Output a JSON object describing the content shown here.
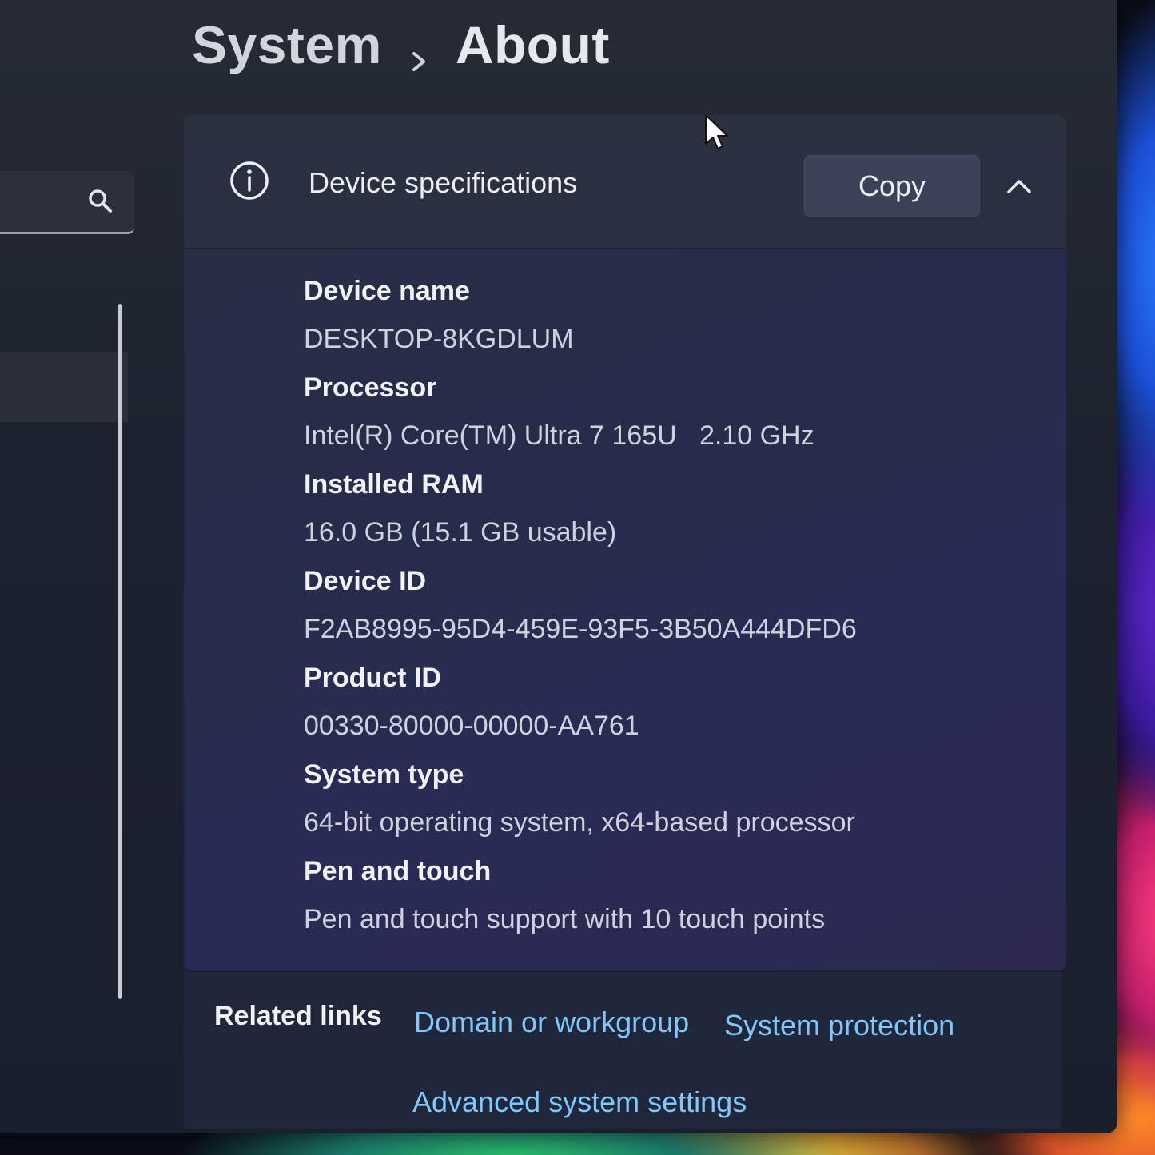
{
  "breadcrumb": {
    "parent": "System",
    "current": "About"
  },
  "search": {
    "placeholder": ""
  },
  "device_specs": {
    "title": "Device specifications",
    "copy_label": "Copy",
    "items": [
      {
        "label": "Device name",
        "value": "DESKTOP-8KGDLUM"
      },
      {
        "label": "Processor",
        "value": "Intel(R) Core(TM) Ultra 7 165U   2.10 GHz"
      },
      {
        "label": "Installed RAM",
        "value": "16.0 GB (15.1 GB usable)"
      },
      {
        "label": "Device ID",
        "value": "F2AB8995-95D4-459E-93F5-3B50A444DFD6"
      },
      {
        "label": "Product ID",
        "value": "00330-80000-00000-AA761"
      },
      {
        "label": "System type",
        "value": "64-bit operating system, x64-based processor"
      },
      {
        "label": "Pen and touch",
        "value": "Pen and touch support with 10 touch points"
      }
    ]
  },
  "related_links": {
    "title": "Related links",
    "domain": "Domain or workgroup",
    "protection": "System protection",
    "advanced": "Advanced system settings"
  },
  "colors": {
    "accent_link": "#7cc8ff",
    "card_bg": "#2a2f44",
    "window_bg": "#1d2230"
  }
}
